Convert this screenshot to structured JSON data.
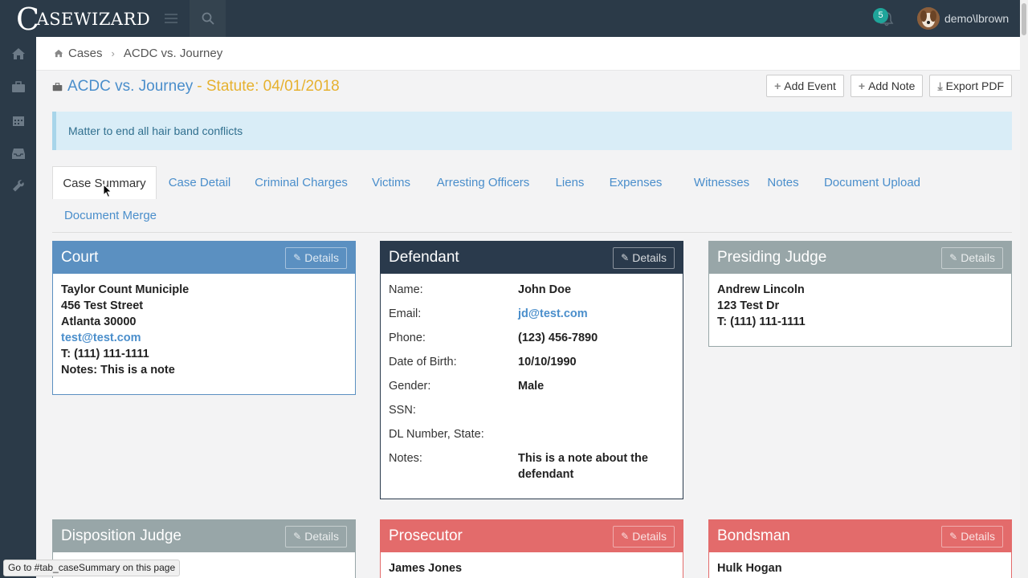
{
  "app": {
    "logo_cap": "C",
    "logo_rest": "ASEWIZARD"
  },
  "topbar": {
    "notification_count": "5",
    "username": "demo\\lbrown"
  },
  "breadcrumb": {
    "items": [
      "Cases",
      "ACDC vs. Journey"
    ]
  },
  "case": {
    "name": "ACDC vs. Journey",
    "statute": "- Statute: 04/01/2018",
    "description": "Matter to end all hair band conflicts"
  },
  "actions": {
    "add_event": "Add Event",
    "add_note": "Add Note",
    "export_pdf": "Export PDF"
  },
  "tabs": [
    "Case Summary",
    "Case Detail",
    "Criminal Charges",
    "Victims",
    "Arresting Officers",
    "Liens",
    "Expenses",
    "Witnesses",
    "Notes",
    "Document Upload",
    "Document Merge"
  ],
  "details_label": "Details",
  "court": {
    "title": "Court",
    "lines": [
      "Taylor Count Municiple",
      "456 Test Street",
      "Atlanta 30000"
    ],
    "email": "test@test.com",
    "phone": "T: (111) 111-1111",
    "notes": "Notes: This is a note"
  },
  "defendant": {
    "title": "Defendant",
    "fields": [
      {
        "label": "Name:",
        "value": "John Doe"
      },
      {
        "label": "Email:",
        "value": "jd@test.com"
      },
      {
        "label": "Phone:",
        "value": "(123) 456-7890"
      },
      {
        "label": "Date of Birth:",
        "value": "10/10/1990"
      },
      {
        "label": "Gender:",
        "value": "Male"
      },
      {
        "label": "SSN:",
        "value": ""
      },
      {
        "label": "DL Number, State:",
        "value": ""
      },
      {
        "label": "Notes:",
        "value": "This is a note about the defendant"
      }
    ]
  },
  "judge": {
    "title": "Presiding Judge",
    "lines": [
      "Andrew Lincoln",
      "123 Test Dr",
      "T: (111) 111-1111"
    ]
  },
  "disposition_judge": {
    "title": "Disposition Judge"
  },
  "prosecutor": {
    "title": "Prosecutor",
    "name": "James Jones"
  },
  "bondsman": {
    "title": "Bondsman",
    "name": "Hulk Hogan"
  },
  "status_bar": "Go to #tab_caseSummary on this page",
  "colors": {
    "topbar": "#2b3a48",
    "court": "#5b90c1",
    "defendant": "#2a3a4c",
    "judge": "#98a6a8",
    "prosecutor": "#e36b6b",
    "link": "#4a8ecb",
    "statute": "#e6b12f"
  },
  "icons": [
    "home-icon",
    "briefcase-icon",
    "calendar-icon",
    "inbox-icon",
    "wrench-icon",
    "search-icon",
    "bell-icon",
    "hamburger-icon"
  ]
}
